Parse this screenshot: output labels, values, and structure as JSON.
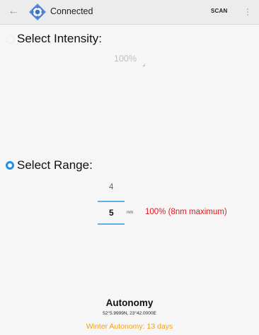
{
  "appbar": {
    "title": "Connected",
    "scan_label": "SCAN"
  },
  "intensity": {
    "label": "Select Intensity:",
    "value": "100%",
    "selected": false
  },
  "range": {
    "label": "Select Range:",
    "selected": true,
    "previous_value": "4",
    "current_value": "5",
    "unit": "nm",
    "note": "100% (8nm maximum)"
  },
  "autonomy": {
    "title": "Autonomy",
    "coordinates": "52°5.9999N, 23°42.0000E",
    "winter": "Winter Autonomy: 13 days"
  },
  "colors": {
    "accent": "#1f8fea",
    "warning_red": "#e0191b",
    "autonomy_orange": "#f0a11a"
  },
  "icons": [
    "back-arrow-icon",
    "compass-target-icon",
    "more-vert-icon"
  ]
}
